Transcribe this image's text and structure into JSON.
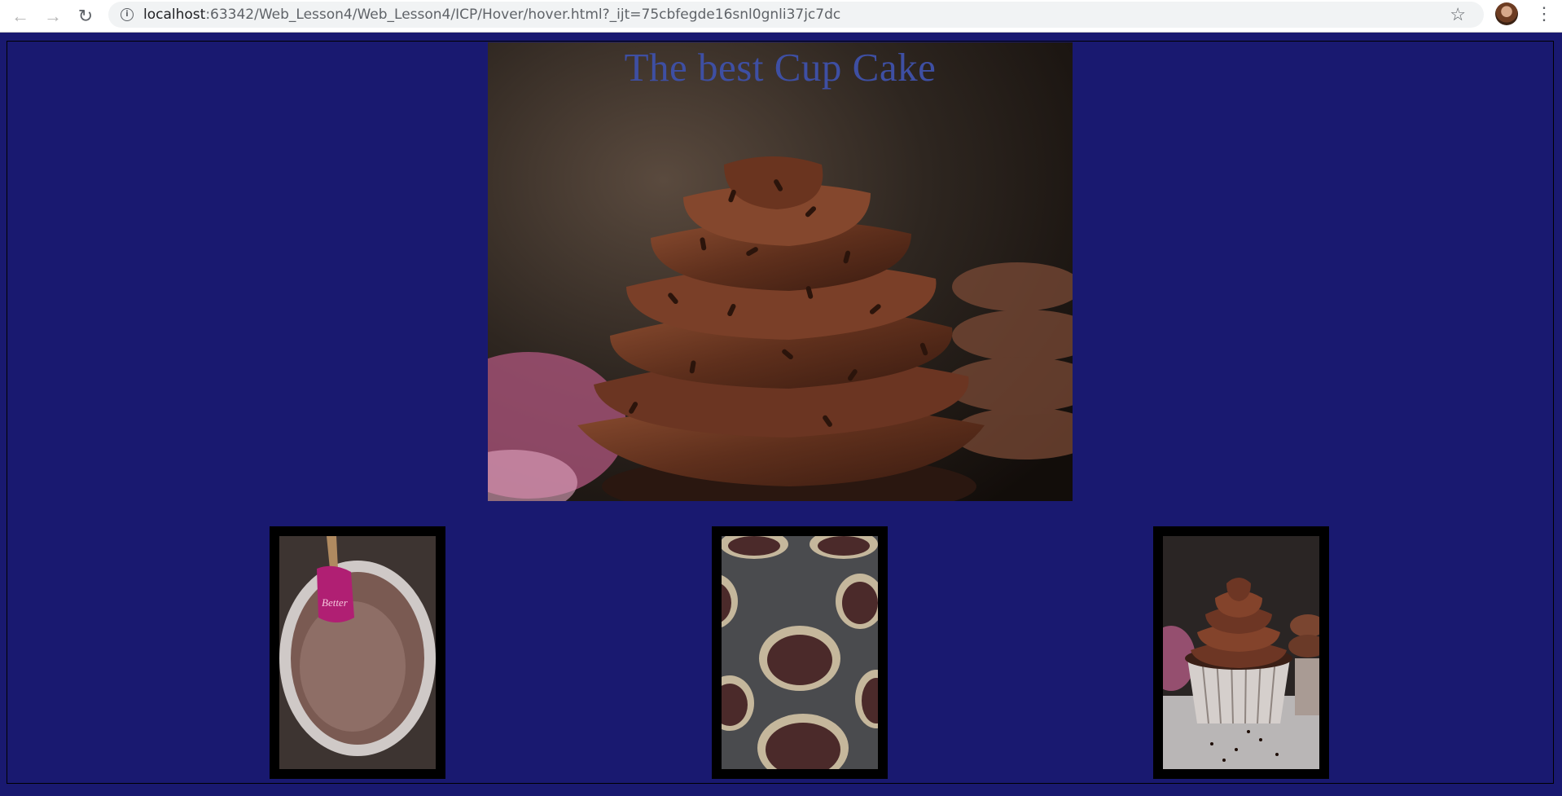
{
  "browser": {
    "url_host": "localhost",
    "url_rest": ":63342/Web_Lesson4/Web_Lesson4/ICP/Hover/hover.html?_ijt=75cbfegde16snl0gnli37jc7dc",
    "icons": [
      "back-arrow-icon",
      "forward-arrow-icon",
      "reload-icon",
      "info-icon",
      "star-icon",
      "menu-icon"
    ]
  },
  "page": {
    "title": "The best Cup Cake",
    "background": "#191970",
    "title_color": "#3e4fa3"
  },
  "gallery": [
    {
      "subject": "batter-bowl"
    },
    {
      "subject": "batter-in-tin"
    },
    {
      "subject": "finished-cupcake"
    }
  ]
}
